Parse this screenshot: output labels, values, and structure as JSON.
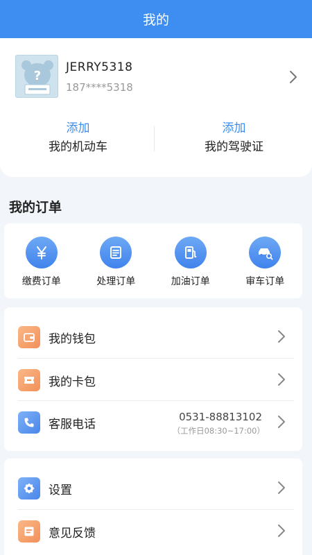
{
  "header": {
    "title": "我的"
  },
  "profile": {
    "username": "JERRY5318",
    "phone": "187****5318",
    "actions": [
      {
        "link": "添加",
        "label": "我的机动车"
      },
      {
        "link": "添加",
        "label": "我的驾驶证"
      }
    ]
  },
  "orders": {
    "title": "我的订单",
    "items": [
      {
        "label": "缴费订单",
        "icon": "yen-icon"
      },
      {
        "label": "处理订单",
        "icon": "document-icon"
      },
      {
        "label": "加油订单",
        "icon": "fuel-pump-icon"
      },
      {
        "label": "审车订单",
        "icon": "car-inspection-icon"
      }
    ]
  },
  "menu1": {
    "items": [
      {
        "label": "我的钱包",
        "icon": "wallet-icon"
      },
      {
        "label": "我的卡包",
        "icon": "card-icon"
      },
      {
        "label": "客服电话",
        "icon": "phone-icon",
        "value": "0531-88813102",
        "hours": "（工作日08:30~17:00）"
      }
    ]
  },
  "menu2": {
    "items": [
      {
        "label": "设置",
        "icon": "settings-icon"
      },
      {
        "label": "意见反馈",
        "icon": "feedback-icon"
      }
    ]
  },
  "colors": {
    "primary": "#3d8ef0",
    "orange": "#f3905a",
    "background": "#f2f5f9"
  }
}
